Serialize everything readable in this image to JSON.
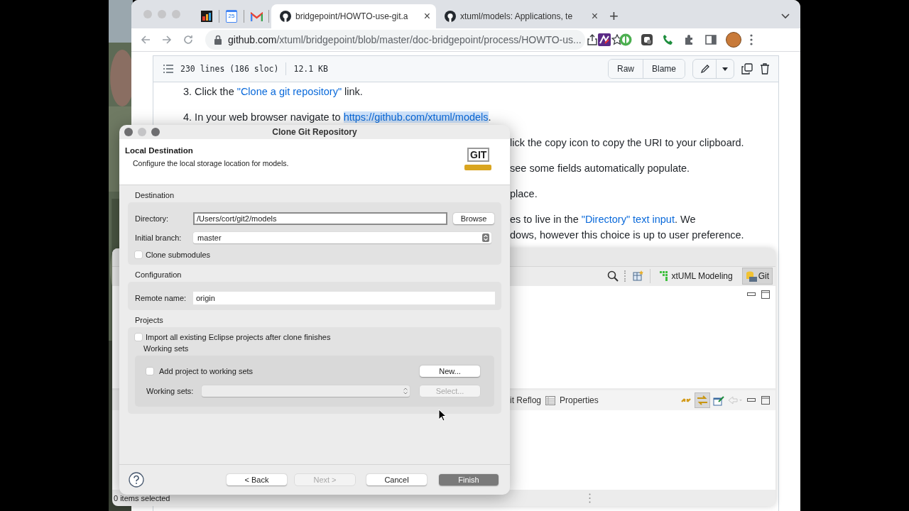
{
  "browser": {
    "pinned_tabs": [
      {
        "selected": false
      },
      {
        "selected": false,
        "icon_text": "25"
      },
      {
        "selected": false
      }
    ],
    "tabs": [
      {
        "title": "bridgepoint/HOWTO-use-git.a",
        "selected": true,
        "close": "×"
      },
      {
        "title": "xtuml/models: Applications, te",
        "selected": false,
        "close": "×"
      }
    ],
    "new_tab": "+",
    "address": {
      "host": "github.com",
      "path": "/xtuml/bridgepoint/blob/master/doc-bridgepoint/process/HOWTO-us..."
    }
  },
  "file_header": {
    "lines": "230 lines (186 sloc)",
    "size": "12.1 KB",
    "buttons": [
      "Raw",
      "Blame"
    ]
  },
  "document": [
    {
      "kind": "step",
      "parts": [
        {
          "kind": "text",
          "text": "3. Click the "
        },
        {
          "kind": "link",
          "text": "\"Clone a git repository\"",
          "highlighted": false
        },
        {
          "kind": "text",
          "text": " link."
        }
      ]
    },
    {
      "kind": "step",
      "parts": [
        {
          "kind": "text",
          "text": "4. In your web browser navigate to "
        },
        {
          "kind": "link",
          "text": "https://github.com/xtuml/models",
          "highlighted": true
        },
        {
          "kind": "text",
          "text": "."
        }
      ]
    },
    {
      "kind": "continued",
      "parts": [
        {
          "kind": "text",
          "text": "lick the copy icon to copy the URI to your clipboard."
        }
      ]
    },
    {
      "kind": "continued",
      "parts": [
        {
          "kind": "text",
          "text": "see some fields automatically populate."
        }
      ]
    },
    {
      "kind": "continued",
      "parts": [
        {
          "kind": "text",
          "text": "place."
        }
      ]
    },
    {
      "kind": "continued",
      "parts": [
        {
          "kind": "text",
          "text": "es to live in the "
        },
        {
          "kind": "link",
          "text": "\"Directory\" text input",
          "highlighted": false
        },
        {
          "kind": "text",
          "text": ". We"
        }
      ]
    },
    {
      "kind": "wrap",
      "parts": [
        {
          "kind": "text",
          "text": "dows, however this choice is up to user preference."
        }
      ]
    }
  ],
  "eclipse": {
    "perspectives": [
      {
        "label": "xtUML Modeling",
        "selected": false
      },
      {
        "label": "Git",
        "selected": true
      }
    ],
    "bottom_tabs": [
      "it Reflog",
      "Properties"
    ],
    "status": "0 items selected"
  },
  "dialog": {
    "title": "Clone Git Repository",
    "header": {
      "title": "Local Destination",
      "description": "Configure the local storage location for models.",
      "logo_text": "GIT"
    },
    "destination": {
      "label": "Destination",
      "directory_label": "Directory:",
      "directory": "/Users/cort/git2/models",
      "browse": "Browse",
      "branch_label": "Initial branch:",
      "branch": "master",
      "submodules": {
        "label": "Clone submodules",
        "checked": false
      }
    },
    "configuration": {
      "label": "Configuration",
      "remote_label": "Remote name:",
      "remote": "origin"
    },
    "projects": {
      "label": "Projects",
      "import_all": {
        "label": "Import all existing Eclipse projects after clone finishes",
        "checked": false
      },
      "working_sets": {
        "label": "Working sets",
        "add": {
          "label": "Add project to working sets",
          "checked": false
        },
        "new_button": "New...",
        "field_label": "Working sets:",
        "select_button": {
          "label": "Select...",
          "disabled": true
        }
      }
    },
    "buttons": [
      {
        "label": "< Back",
        "kind": "normal",
        "disabled": false
      },
      {
        "label": "Next >",
        "kind": "normal",
        "disabled": true
      },
      {
        "label": "Cancel",
        "kind": "normal",
        "disabled": false
      },
      {
        "label": "Finish",
        "kind": "primary",
        "disabled": false
      }
    ]
  }
}
